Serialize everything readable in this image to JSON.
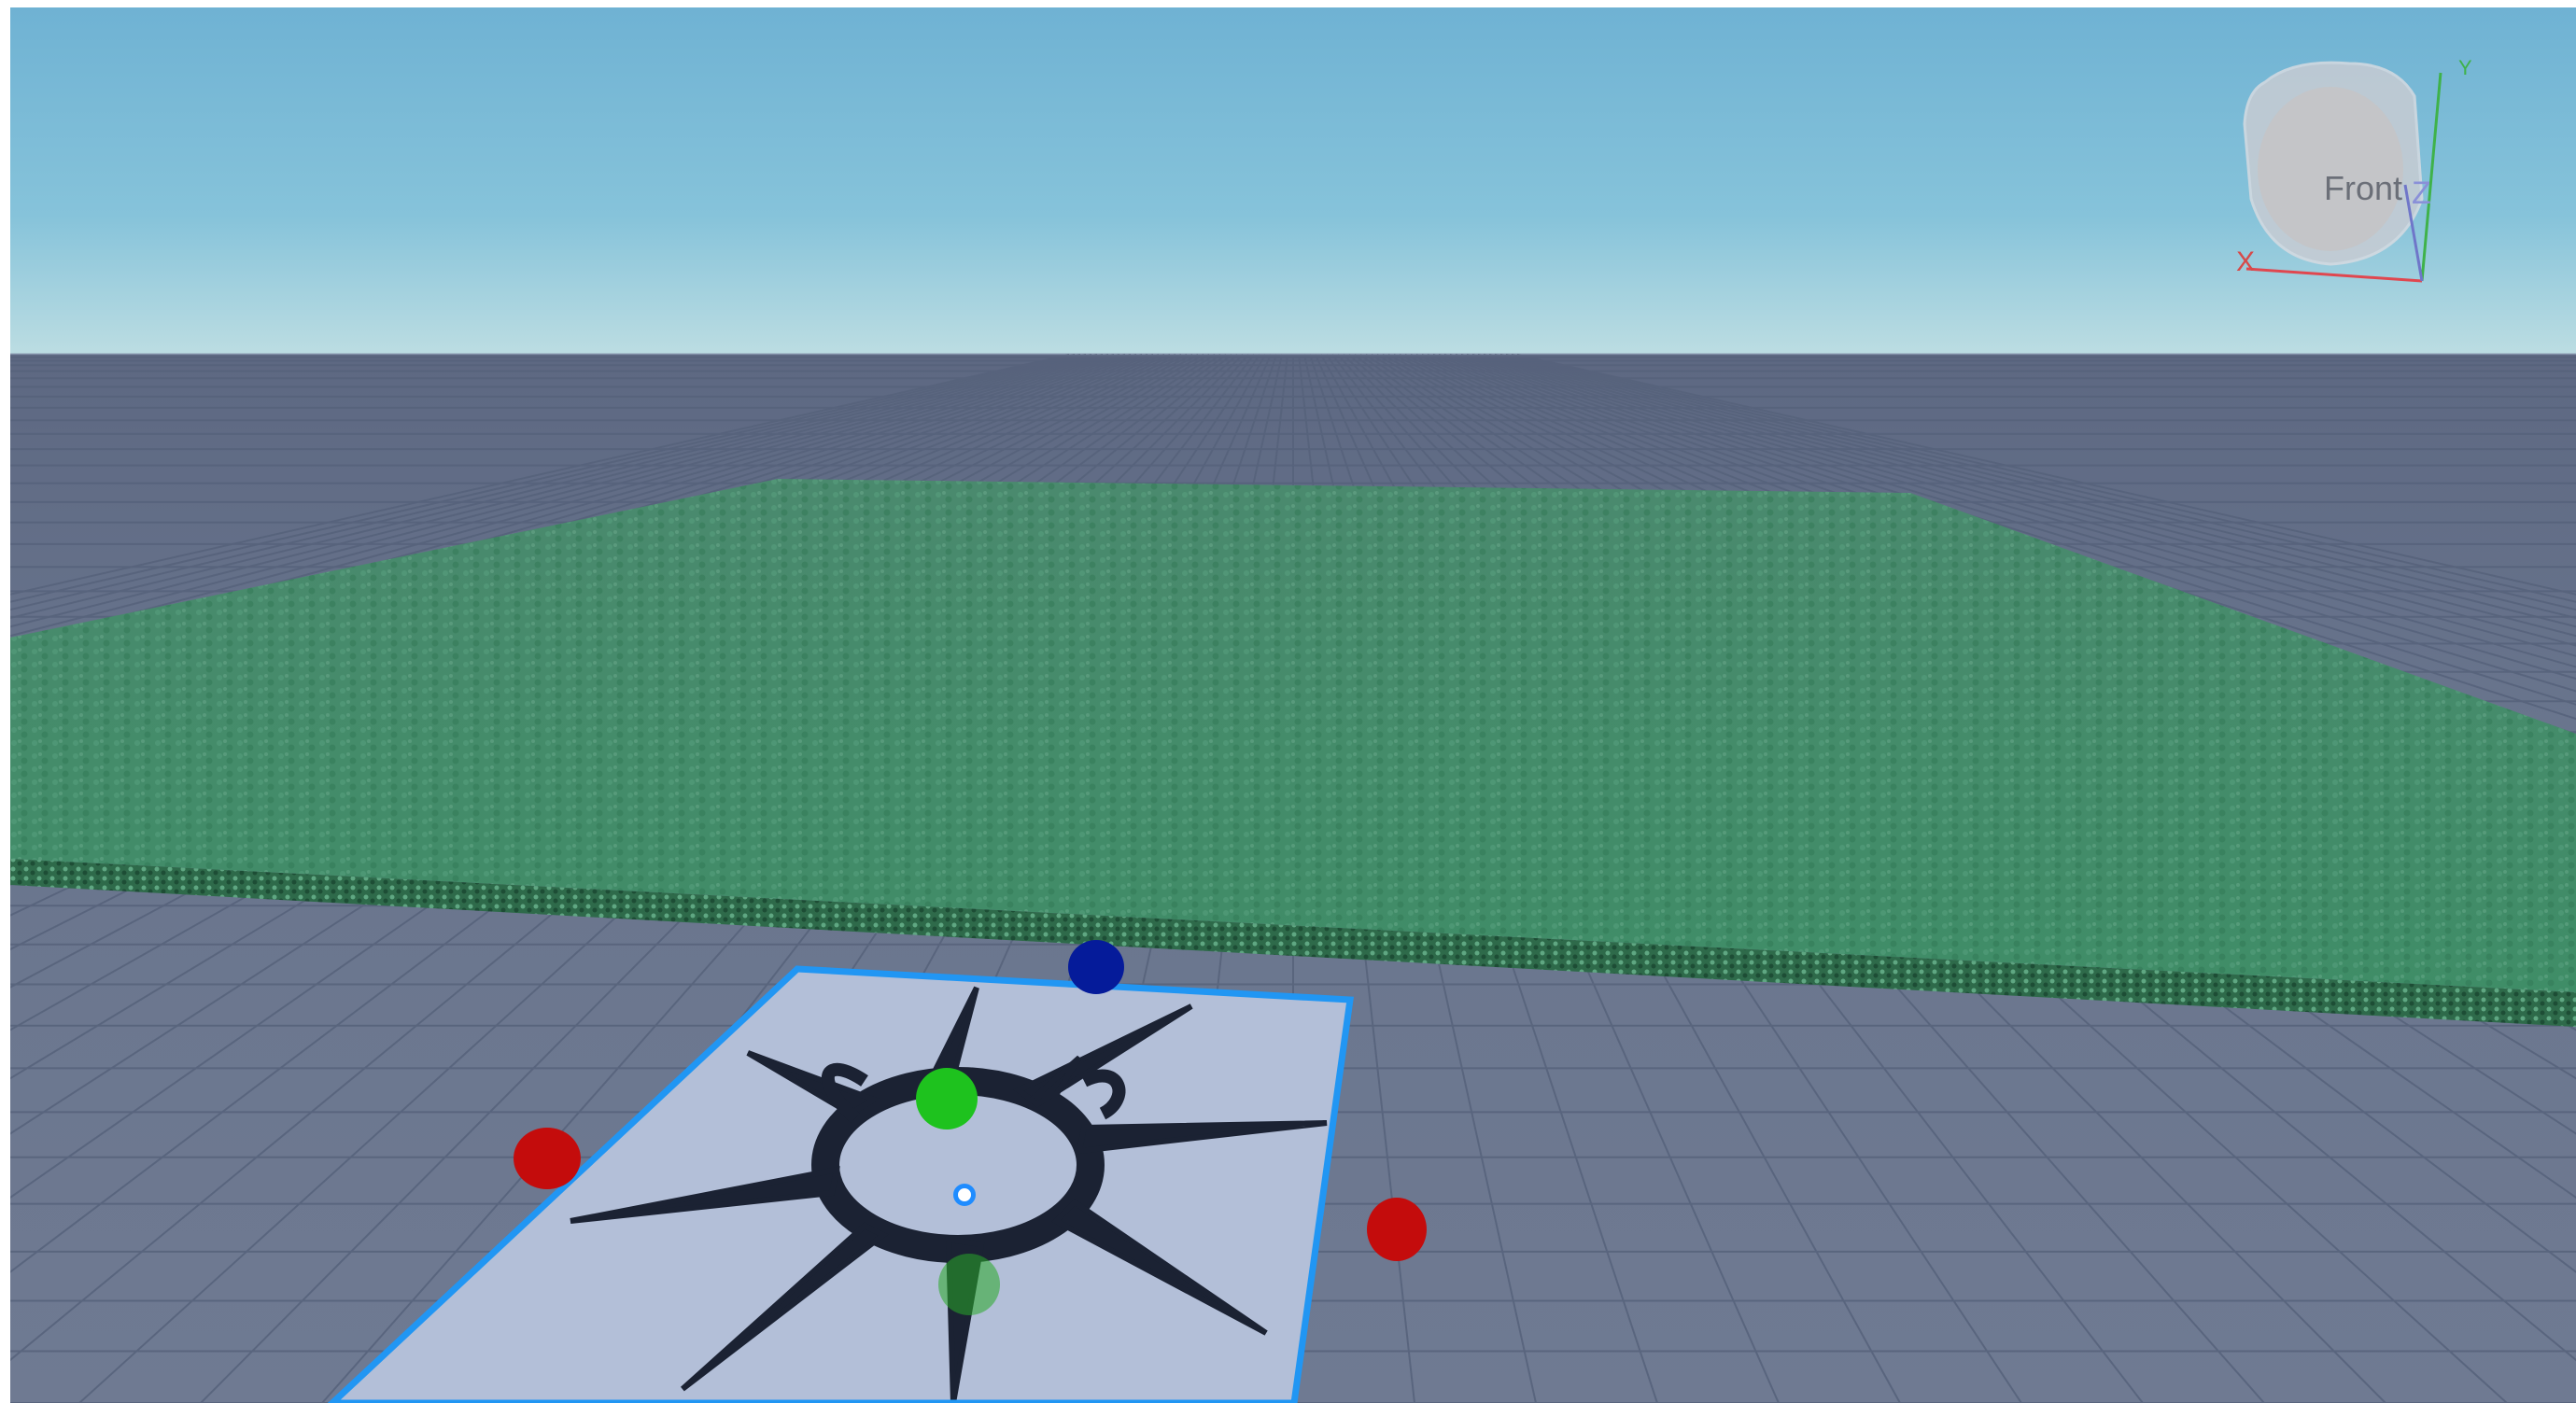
{
  "viewport": {
    "sky_top_color": "#6cb4d6",
    "sky_horizon_color": "#b9dbe3",
    "ground_color": "#6a768e",
    "grid_line_color": "#5b6781",
    "baseplate_color": "#3f8a66",
    "selection_outline_color": "#2196f3",
    "decal_background_color": "#b3bfd8",
    "decal_stroke_color": "#1b2233"
  },
  "view_cube": {
    "face_label": "Front",
    "axis_x_label": "X",
    "axis_y_label": "Y",
    "axis_z_label": "Z",
    "axis_x_color": "#e0474f",
    "axis_y_color": "#3fb24a",
    "axis_z_color": "#8a90d8"
  },
  "transform_handles": {
    "x_axis_color": "#c40c0c",
    "y_axis_color": "#1ec21e",
    "z_axis_color": "#051b9a",
    "pivot_color": "#1f8cff"
  }
}
